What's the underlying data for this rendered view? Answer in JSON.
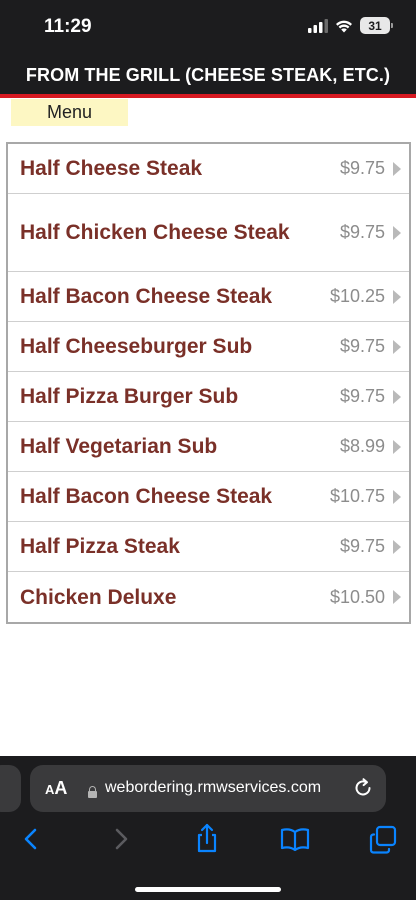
{
  "status_bar": {
    "time": "11:29",
    "battery": "31",
    "icons": [
      "signal-icon",
      "wifi-icon",
      "battery-icon"
    ]
  },
  "header": {
    "title": "FROM THE GRILL (CHEESE STEAK, ETC.)",
    "stripe_color": "#d71921"
  },
  "menu_tab": {
    "label": "Menu"
  },
  "items": [
    {
      "name": "Half Cheese Steak",
      "price": "$9.75"
    },
    {
      "name": "Half Chicken Cheese Steak",
      "price": "$9.75"
    },
    {
      "name": "Half Bacon Cheese Steak",
      "price": "$10.25"
    },
    {
      "name": "Half Cheeseburger Sub",
      "price": "$9.75"
    },
    {
      "name": "Half Pizza Burger Sub",
      "price": "$9.75"
    },
    {
      "name": "Half Vegetarian Sub",
      "price": "$8.99"
    },
    {
      "name": "Half Bacon Cheese Steak",
      "price": "$10.75"
    },
    {
      "name": "Half Pizza Steak",
      "price": "$9.75"
    },
    {
      "name": "Chicken Deluxe",
      "price": "$10.50"
    }
  ],
  "browser": {
    "aa_small": "A",
    "aa_large": "A",
    "url": "webordering.rmwservices.com",
    "nav_icons": [
      "back-icon",
      "forward-icon",
      "share-icon",
      "bookmarks-icon",
      "tabs-icon"
    ]
  },
  "colors": {
    "item_name": "#7a3028",
    "price": "#8c8c8c",
    "menu_tab_bg": "#fdf7c3",
    "accent_blue": "#0a84ff"
  }
}
